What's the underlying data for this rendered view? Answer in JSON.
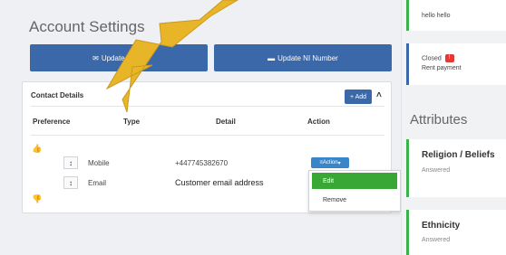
{
  "account": {
    "title": "Account Settings",
    "update_email_label": "Update Email",
    "update_ni_label": "Update NI Number"
  },
  "contact": {
    "title": "Contact Details",
    "add_label": "+ Add",
    "columns": [
      "Preference",
      "Type",
      "Detail",
      "Action"
    ],
    "rows": [
      {
        "type": "Mobile",
        "detail": "+447745382670",
        "action": "Action"
      },
      {
        "type": "Email",
        "detail": "Customer email address"
      }
    ],
    "menu": {
      "edit": "Edit",
      "remove": "Remove"
    }
  },
  "side": {
    "note1": "hello hello",
    "note2_status": "Closed",
    "note2_text": "Rent payment",
    "attributes_title": "Attributes",
    "religion_title": "Religion / Beliefs",
    "religion_status": "Answered",
    "ethnicity_title": "Ethnicity",
    "ethnicity_status": "Answered"
  },
  "colors": {
    "primary": "#3a68a8",
    "success": "#39a735",
    "danger": "#e53935",
    "annotation": "#e8b528"
  }
}
